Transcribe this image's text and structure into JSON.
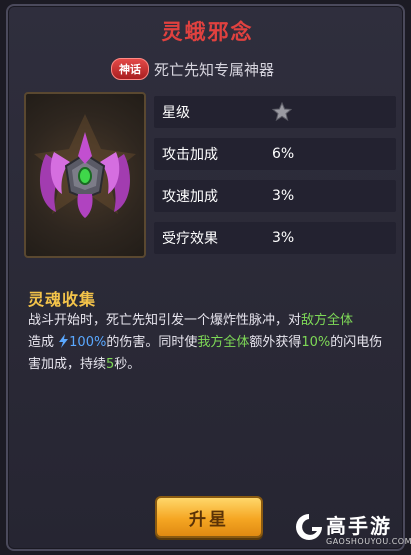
{
  "item": {
    "name": "灵蛾邪念",
    "tag": "神话",
    "subtitle": "死亡先知专属神器"
  },
  "stats": [
    {
      "label": "星级",
      "value": "",
      "icon": "star-icon"
    },
    {
      "label": "攻击加成",
      "value": "6%"
    },
    {
      "label": "攻速加成",
      "value": "3%"
    },
    {
      "label": "受疗效果",
      "value": "3%"
    }
  ],
  "skill": {
    "title": "灵魂收集",
    "desc_1": "战斗开始时，死亡先知引发一个爆炸性脉冲，对",
    "desc_hl_1": "敌方全体",
    "desc_2": "造成",
    "desc_hl_2": "100%",
    "desc_3": "的伤害。同时使",
    "desc_hl_3": "我方全体",
    "desc_4": "额外获得",
    "desc_hl_4": "10%",
    "desc_5": "的闪电伤害加成，持续",
    "desc_hl_5": "5",
    "desc_6": "秒。"
  },
  "actions": {
    "upgrade_label": "升星"
  },
  "watermark": {
    "text": "高手游",
    "sub": "GAOSHOUYOU.COM"
  },
  "colors": {
    "title": "#e0413f",
    "highlight": "#7ed957",
    "lightning": "#5aa8ff",
    "skill_title": "#f3c34a",
    "button": "#f5a623"
  }
}
